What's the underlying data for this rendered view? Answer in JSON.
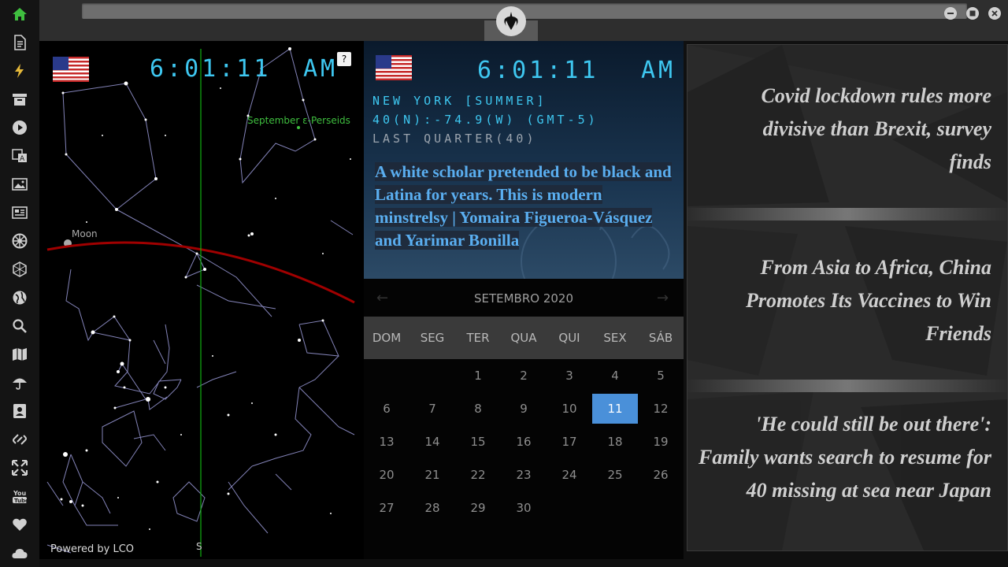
{
  "sidebar": {
    "icons": [
      "home-icon",
      "document-icon",
      "bolt-icon",
      "archive-icon",
      "play-icon",
      "translate-icon",
      "image-icon",
      "newspaper-icon",
      "empire-icon",
      "hexagon-icon",
      "globe-icon",
      "search-icon",
      "map-icon",
      "umbrella-icon",
      "contact-card-icon",
      "link-icon",
      "fullscreen-icon",
      "youtube-icon",
      "heart-icon",
      "cloud-icon"
    ],
    "active_color": "#3fbf3f"
  },
  "sky": {
    "time": "6:01:11",
    "ampm": "AM",
    "help_label": "?",
    "meteor_label": "September ε-Perseids",
    "moon_label": "Moon",
    "south_label": "S",
    "powered_by": "Powered by LCO"
  },
  "world": {
    "time": "6:01:11",
    "ampm": "AM",
    "city": "NEW YORK [SUMMER]",
    "coords": "40(N):-74.9(W) (GMT-5)",
    "moon_phase": "LAST QUARTER(40)",
    "headline": "A white scholar pretended to be black and Latina for years. This is modern minstrelsy | Yomaira Figueroa-Vásquez and Yarimar Bonilla"
  },
  "calendar": {
    "month": "SETEMBRO 2020",
    "prev": "←",
    "next": "→",
    "weekdays": [
      "DOM",
      "SEG",
      "TER",
      "QUA",
      "QUI",
      "SEX",
      "SÁB"
    ],
    "selected_day": "11",
    "weeks": [
      [
        "",
        "",
        "1",
        "2",
        "3",
        "4",
        "5"
      ],
      [
        "6",
        "7",
        "8",
        "9",
        "10",
        "11",
        "12"
      ],
      [
        "13",
        "14",
        "15",
        "16",
        "17",
        "18",
        "19"
      ],
      [
        "20",
        "21",
        "22",
        "23",
        "24",
        "25",
        "26"
      ],
      [
        "27",
        "28",
        "29",
        "30",
        "",
        "",
        ""
      ]
    ]
  },
  "news": {
    "items": [
      "Covid lockdown rules more divisive than Brexit, survey finds",
      "From Asia to Africa, China Promotes Its Vaccines to Win Friends",
      "'He could still be out there': Family wants search to resume for 40 missing at sea near Japan"
    ]
  }
}
